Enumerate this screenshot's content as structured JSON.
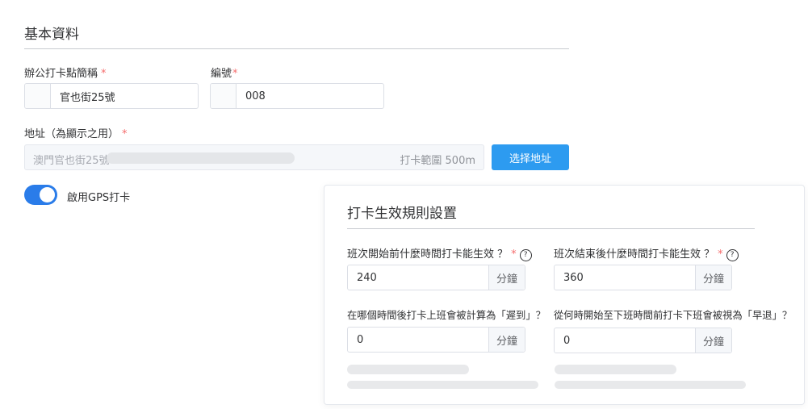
{
  "basic": {
    "title": "基本資料",
    "name_label": "辦公打卡點簡稱",
    "name_value": "官也街25號",
    "code_label": "編號",
    "code_value": "008",
    "address_label": "地址（為顯示之用）",
    "address_value": "澳門官也街25號",
    "range_text": "打卡範圍 500m",
    "select_address_button": "选择地址",
    "required_mark": "*"
  },
  "gps": {
    "label": "啟用GPS打卡",
    "enabled": true
  },
  "rules": {
    "title": "打卡生效規則設置",
    "unit": "分鐘",
    "help_glyph": "?",
    "fields": [
      {
        "label": "班次開始前什麼時間打卡能生效 ？",
        "value": "240",
        "required": true,
        "help": true
      },
      {
        "label": "班次結束後什麼時間打卡能生效 ？",
        "value": "360",
        "required": true,
        "help": true
      },
      {
        "label": "在哪個時間後打卡上班會被計算為「遲到」？",
        "value": "0",
        "required": false,
        "help": false
      },
      {
        "label": "從何時開始至下班時間前打卡下班會被視為「早退」？",
        "value": "0",
        "required": false,
        "help": false
      }
    ]
  },
  "colors": {
    "primary": "#2d9bf0",
    "switch_on": "#2a7ce9",
    "required": "#f56c6c"
  }
}
